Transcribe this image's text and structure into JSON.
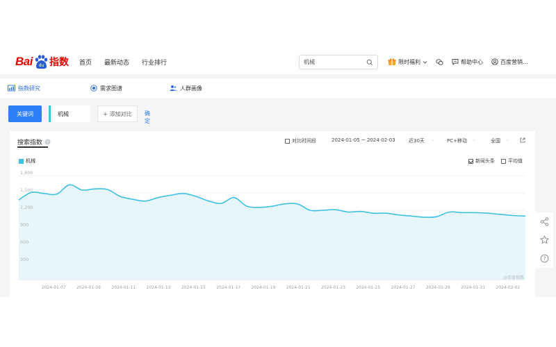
{
  "header": {
    "logo_bai": "Bai",
    "logo_du": "du",
    "logo_zhishu": "指数",
    "nav": [
      "首页",
      "最新动态",
      "行业排行"
    ],
    "search_value": "机械",
    "promo_label": "限时福利",
    "help_label": "帮助中心",
    "user_label": "百度营销..."
  },
  "tabs": {
    "trend": "指数研究",
    "demand": "需求图谱",
    "crowd": "人群画像"
  },
  "query": {
    "keyword_button": "关键词",
    "keyword": "机械",
    "add_compare": "+ 添加对比",
    "confirm": "确定"
  },
  "card": {
    "title": "搜索指数",
    "compare_period": "对比时间段",
    "date_range": "2024-01-05 ~ 2024-02-03",
    "period": "近30天",
    "device": "PC+移动",
    "region": "全国",
    "news_label": "新闻头条",
    "avg_label": "平均值",
    "watermark": "@百度指数"
  },
  "chart_data": {
    "type": "area",
    "series": [
      {
        "name": "机械",
        "color": "#3ec1e0",
        "values": [
          1380,
          1510,
          1490,
          1480,
          1640,
          1550,
          1570,
          1560,
          1440,
          1390,
          1360,
          1420,
          1460,
          1490,
          1440,
          1360,
          1320,
          1420,
          1270,
          1250,
          1270,
          1310,
          1310,
          1200,
          1200,
          1210,
          1170,
          1180,
          1150,
          1150,
          1120,
          1100,
          1080,
          1090,
          1170,
          1160,
          1160,
          1150,
          1130,
          1110,
          1100
        ]
      }
    ],
    "x_start": "2024-01-05",
    "x_end": "2024-02-03",
    "x_ticks": [
      "2024-01-07",
      "2024-01-09",
      "2024-01-11",
      "2024-01-13",
      "2024-01-15",
      "2024-01-17",
      "2024-01-19",
      "2024-01-21",
      "2024-01-23",
      "2024-01-25",
      "2024-01-27",
      "2024-01-29",
      "2024-01-31",
      "2024-02-02"
    ],
    "y_ticks": [
      300,
      600,
      900,
      1200,
      1500,
      1800
    ],
    "ylim": [
      0,
      1800
    ],
    "grid": true
  }
}
